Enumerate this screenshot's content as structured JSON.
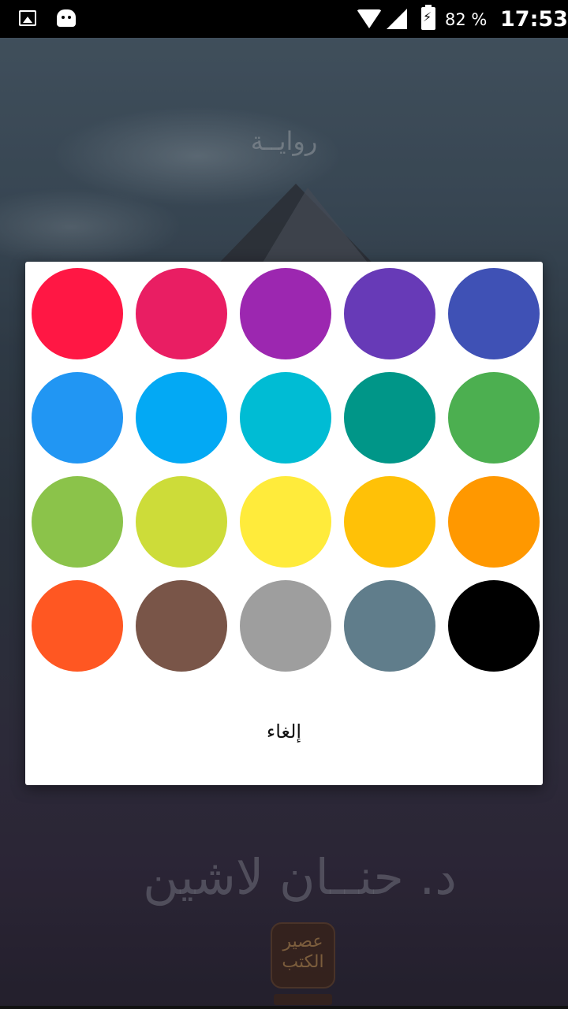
{
  "status_bar": {
    "battery_percent": "82 %",
    "time": "17:53",
    "icons": [
      "image-icon",
      "android-debug-icon",
      "wifi-icon",
      "signal-icon",
      "battery-charging-icon"
    ]
  },
  "background_cover": {
    "genre": "روايــة",
    "author": "د. حنــان لاشين",
    "publisher": "عصير الكتب"
  },
  "color_picker": {
    "swatches": [
      {
        "name": "red",
        "color": "#FF1744"
      },
      {
        "name": "pink",
        "color": "#E91E63"
      },
      {
        "name": "purple",
        "color": "#9C27B0"
      },
      {
        "name": "deep-purple",
        "color": "#673AB7"
      },
      {
        "name": "indigo",
        "color": "#3F51B5"
      },
      {
        "name": "blue",
        "color": "#2196F3"
      },
      {
        "name": "light-blue",
        "color": "#03A9F4"
      },
      {
        "name": "cyan",
        "color": "#00BCD4"
      },
      {
        "name": "teal",
        "color": "#009688"
      },
      {
        "name": "green",
        "color": "#4CAF50"
      },
      {
        "name": "light-green",
        "color": "#8BC34A"
      },
      {
        "name": "lime",
        "color": "#CDDC39"
      },
      {
        "name": "yellow",
        "color": "#FFEB3B"
      },
      {
        "name": "amber",
        "color": "#FFC107"
      },
      {
        "name": "orange",
        "color": "#FF9800"
      },
      {
        "name": "deep-orange",
        "color": "#FF5722"
      },
      {
        "name": "brown",
        "color": "#795548"
      },
      {
        "name": "grey",
        "color": "#9E9E9E"
      },
      {
        "name": "blue-grey",
        "color": "#607D8B"
      },
      {
        "name": "black",
        "color": "#000000"
      }
    ],
    "cancel_label": "إلغاء"
  }
}
